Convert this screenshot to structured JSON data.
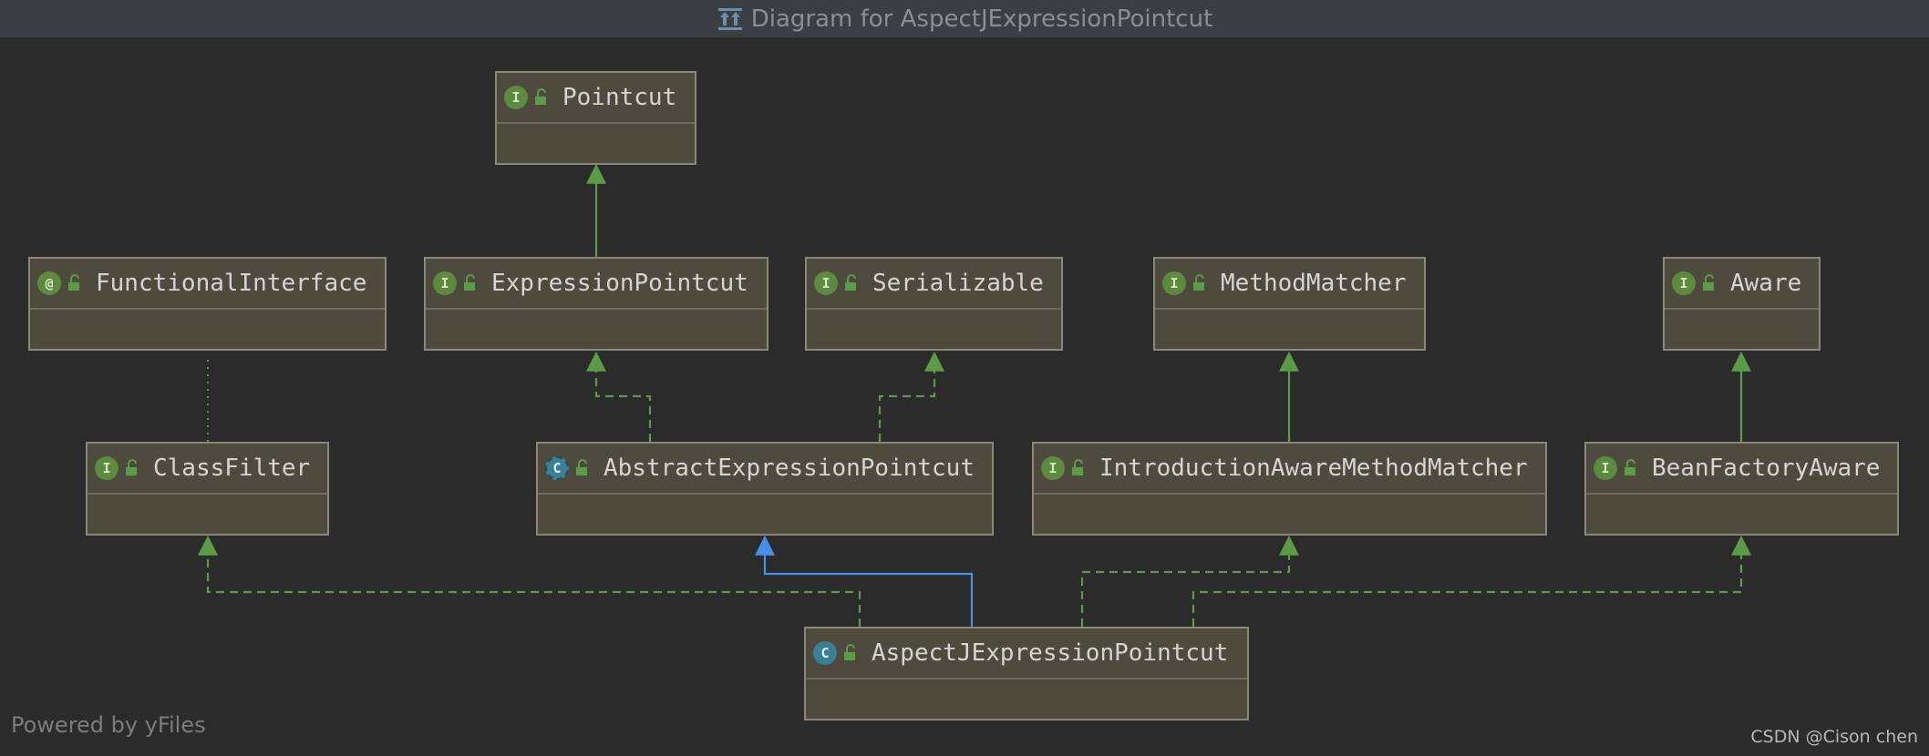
{
  "window": {
    "title": "Diagram for AspectJExpressionPointcut"
  },
  "nodes": {
    "pointcut": {
      "name": "Pointcut",
      "kind": "interface",
      "badge": "I"
    },
    "functional_interface": {
      "name": "FunctionalInterface",
      "kind": "annotation",
      "badge": "@"
    },
    "expression_pointcut": {
      "name": "ExpressionPointcut",
      "kind": "interface",
      "badge": "I"
    },
    "serializable": {
      "name": "Serializable",
      "kind": "interface",
      "badge": "I"
    },
    "method_matcher": {
      "name": "MethodMatcher",
      "kind": "interface",
      "badge": "I"
    },
    "aware": {
      "name": "Aware",
      "kind": "interface",
      "badge": "I"
    },
    "class_filter": {
      "name": "ClassFilter",
      "kind": "interface",
      "badge": "I"
    },
    "abstract_expression_pointcut": {
      "name": "AbstractExpressionPointcut",
      "kind": "abstract-class",
      "badge": "C"
    },
    "introduction_aware_method_matcher": {
      "name": "IntroductionAwareMethodMatcher",
      "kind": "interface",
      "badge": "I"
    },
    "bean_factory_aware": {
      "name": "BeanFactoryAware",
      "kind": "interface",
      "badge": "I"
    },
    "aspectj_expression_pointcut": {
      "name": "AspectJExpressionPointcut",
      "kind": "class",
      "badge": "C"
    }
  },
  "edges": [
    {
      "from": "expression_pointcut",
      "to": "pointcut",
      "type": "extends"
    },
    {
      "from": "abstract_expression_pointcut",
      "to": "expression_pointcut",
      "type": "implements"
    },
    {
      "from": "abstract_expression_pointcut",
      "to": "serializable",
      "type": "implements"
    },
    {
      "from": "class_filter",
      "to": "functional_interface",
      "type": "annotated-by"
    },
    {
      "from": "introduction_aware_method_matcher",
      "to": "method_matcher",
      "type": "extends"
    },
    {
      "from": "bean_factory_aware",
      "to": "aware",
      "type": "extends"
    },
    {
      "from": "aspectj_expression_pointcut",
      "to": "class_filter",
      "type": "implements"
    },
    {
      "from": "aspectj_expression_pointcut",
      "to": "abstract_expression_pointcut",
      "type": "extends-class"
    },
    {
      "from": "aspectj_expression_pointcut",
      "to": "introduction_aware_method_matcher",
      "type": "implements"
    },
    {
      "from": "aspectj_expression_pointcut",
      "to": "bean_factory_aware",
      "type": "implements"
    }
  ],
  "colors": {
    "background": "#2b2b2b",
    "titlebar": "#3c3f41",
    "node_fill": "#4e4b3e",
    "node_border": "#8a8878",
    "interface_edge": "#5c9c48",
    "class_edge": "#4a8fe8",
    "interface_badge": "#5c8a3e",
    "class_badge": "#3a7f96"
  },
  "icons": {
    "title": "class-diagram-icon",
    "visibility": "unlocked-padlock-icon"
  },
  "footer": {
    "powered_by": "Powered by yFiles",
    "watermark": "CSDN @Cison chen"
  }
}
